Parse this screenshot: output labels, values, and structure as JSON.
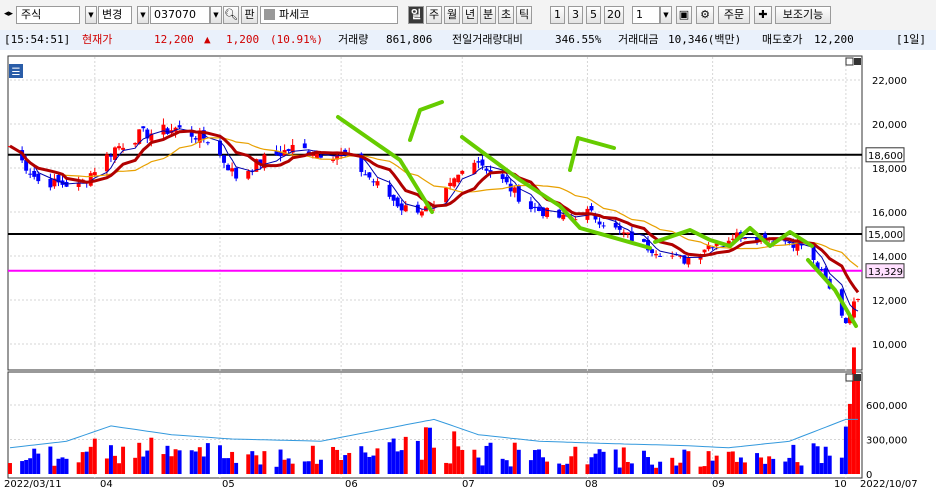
{
  "toolbar": {
    "market_type": "주식",
    "change_label": "변경",
    "stock_code": "037070",
    "pan_label": "판",
    "stock_name": "파세코",
    "period_buttons": [
      "일",
      "주",
      "월",
      "년",
      "분",
      "초",
      "틱"
    ],
    "interval_buttons": [
      "1",
      "3",
      "5",
      "20"
    ],
    "count_value": "1",
    "order_label": "주문",
    "aux_label": "보조기능"
  },
  "status": {
    "time": "[15:54:51]",
    "price_label": "현재가",
    "price": "12,200",
    "arrow": "▲",
    "change": "1,200",
    "change_pct": "(10.91%)",
    "volume_label": "거래량",
    "volume": "861,806",
    "prev_ratio_label": "전일거래량대비",
    "prev_ratio": "346.55%",
    "amount_label": "거래대금",
    "amount": "10,346(백만)",
    "ask_label": "매도호가",
    "ask": "12,200",
    "period_tag": "[1일]"
  },
  "price_panel": {
    "corner_icon": "☰",
    "price_ticks": [
      "22,000",
      "20,000",
      "18,000",
      "16,000",
      "14,000",
      "12,000",
      "10,000"
    ],
    "lines": [
      {
        "label": "18,600",
        "value": 18600,
        "color": "#000000"
      },
      {
        "label": "15,000",
        "value": 15000,
        "color": "#000000"
      },
      {
        "label": "13,329",
        "value": 13329,
        "color": "#ff00ff"
      }
    ]
  },
  "volume_panel": {
    "ticks": [
      "600,000",
      "300,000",
      "0"
    ]
  },
  "x_axis": {
    "labels": [
      "2022/03/11",
      "04",
      "05",
      "06",
      "07",
      "08",
      "09",
      "10",
      "2022/10/07"
    ]
  },
  "colors": {
    "up": "#ff0000",
    "down": "#0000ff",
    "ma_short": "#0000aa",
    "ma_main": "#b00000",
    "ma_long": "#e8a000",
    "vol_line": "#3399dd",
    "annotation": "#66cc00",
    "support": "#ff00ff"
  },
  "chart_data": {
    "type": "candlestick",
    "x_range": [
      "2022/03/11",
      "2022/10/07"
    ],
    "price_range": [
      9000,
      23000
    ],
    "volume_range": [
      0,
      800000
    ],
    "price_anchor_points": [
      [
        "2022/03/11",
        19000
      ],
      [
        "2022/03/18",
        17400
      ],
      [
        "2022/03/28",
        17200
      ],
      [
        "2022/04/06",
        18900
      ],
      [
        "2022/04/12",
        19500
      ],
      [
        "2022/04/21",
        19800
      ],
      [
        "2022/04/29",
        19300
      ],
      [
        "2022/05/06",
        17600
      ],
      [
        "2022/05/13",
        18400
      ],
      [
        "2022/05/20",
        18900
      ],
      [
        "2022/05/27",
        18700
      ],
      [
        "2022/06/02",
        18600
      ],
      [
        "2022/06/09",
        17400
      ],
      [
        "2022/06/16",
        16200
      ],
      [
        "2022/06/24",
        16100
      ],
      [
        "2022/06/29",
        17400
      ],
      [
        "2022/07/04",
        18500
      ],
      [
        "2022/07/11",
        17400
      ],
      [
        "2022/07/18",
        16200
      ],
      [
        "2022/07/26",
        15700
      ],
      [
        "2022/08/01",
        16000
      ],
      [
        "2022/08/08",
        15200
      ],
      [
        "2022/08/16",
        14400
      ],
      [
        "2022/08/25",
        13800
      ],
      [
        "2022/08/31",
        14500
      ],
      [
        "2022/09/08",
        15000
      ],
      [
        "2022/09/16",
        14800
      ],
      [
        "2022/09/23",
        14500
      ],
      [
        "2022/09/28",
        13200
      ],
      [
        "2022/10/04",
        11000
      ],
      [
        "2022/10/07",
        12200
      ]
    ],
    "volume_anchor_points": [
      [
        "2022/03/11",
        120000
      ],
      [
        "2022/03/25",
        150000
      ],
      [
        "2022/04/05",
        220000
      ],
      [
        "2022/04/20",
        180000
      ],
      [
        "2022/05/05",
        160000
      ],
      [
        "2022/05/27",
        150000
      ],
      [
        "2022/06/10",
        200000
      ],
      [
        "2022/06/24",
        250000
      ],
      [
        "2022/07/05",
        180000
      ],
      [
        "2022/07/20",
        150000
      ],
      [
        "2022/08/05",
        140000
      ],
      [
        "2022/08/25",
        130000
      ],
      [
        "2022/09/05",
        120000
      ],
      [
        "2022/09/20",
        150000
      ],
      [
        "2022/10/04",
        250000
      ],
      [
        "2022/10/07",
        861806
      ]
    ],
    "moving_averages": [
      "5",
      "20",
      "60",
      "volume_avg"
    ]
  }
}
